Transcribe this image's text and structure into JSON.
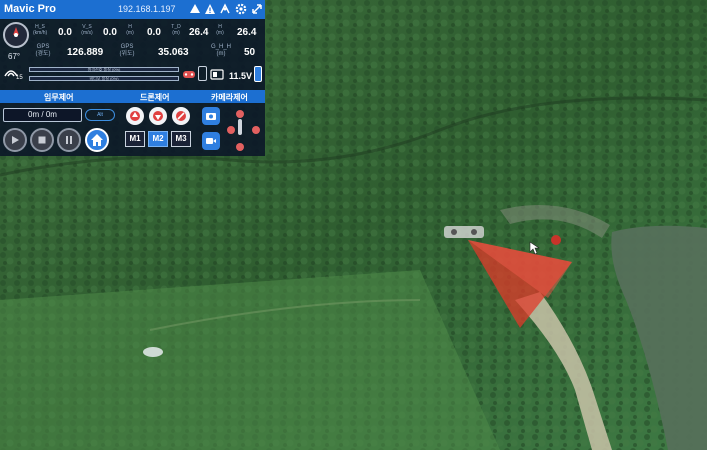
{
  "titlebar": {
    "app_name": "Mavic Pro",
    "ip": "192.168.1.197"
  },
  "telemetry": {
    "heading": "67°",
    "hs_label": "H_S (km/h)",
    "hs_value": "0.0",
    "vs_label": "V_S (m/s)",
    "vs_value": "0.0",
    "h_label": "H (m)",
    "h_value": "0.0",
    "td_label": "T_D (m)",
    "td_value": "26.4",
    "h2_label": "H (m)",
    "h2_value": "26.4",
    "gps_lon_label": "GPS (경도)",
    "gps_lon_value": "126.889",
    "gps_lat_label": "GPS (위도)",
    "gps_lat_value": "35.063",
    "ghh_label": "G_H_H (m)",
    "ghh_value": "50",
    "sat_count": "15",
    "bar1_text": "원격신호 품질 (0%)",
    "bar2_text": "비디오 품질 (0%)",
    "battery": "11.5V"
  },
  "sections": {
    "mission": "임무제어",
    "drone": "드론제어",
    "camera": "카메라제어"
  },
  "mission": {
    "progress": "0m / 0m",
    "mode": "Alt"
  },
  "drone_modes": [
    "M1",
    "M2",
    "M3"
  ],
  "colors": {
    "accent": "#1c6fd1",
    "frustum": "#e03a2a"
  }
}
